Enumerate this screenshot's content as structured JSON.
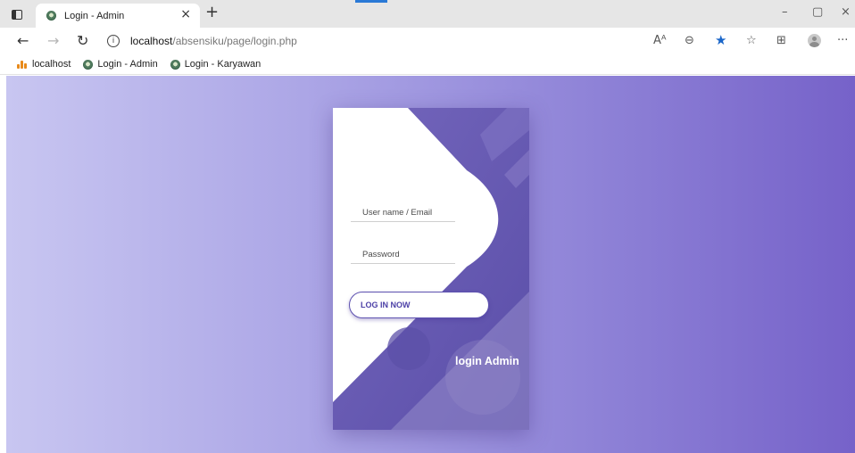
{
  "browser": {
    "tab": {
      "title": "Login - Admin",
      "close": "×"
    },
    "new_tab": "+",
    "window_controls": {
      "minimize": "–",
      "maximize": "▢",
      "close": "×"
    },
    "nav": {
      "back": "←",
      "forward": "→",
      "refresh": "↻"
    },
    "address": {
      "info": "i",
      "host": "localhost",
      "path": "/absensiku/page/login.php"
    },
    "toolbar_icons": {
      "read_aloud": "Aᴬ",
      "zoom": "⊖",
      "favorite": "★",
      "favorites_list": "☆",
      "collections": "⊞",
      "more": "···"
    },
    "bookmarks": [
      {
        "label": "localhost",
        "icon": "xampp-icon"
      },
      {
        "label": "Login - Admin",
        "icon": "site-icon"
      },
      {
        "label": "Login - Karyawan",
        "icon": "site-icon"
      }
    ]
  },
  "login": {
    "username_placeholder": "User name / Email",
    "password_placeholder": "Password",
    "button_label": "LOG IN NOW",
    "heading": "login Admin"
  },
  "colors": {
    "accent_blue": "#1a66c9",
    "purple_dark": "#5e52b0",
    "purple_light": "#c8c6f1"
  }
}
